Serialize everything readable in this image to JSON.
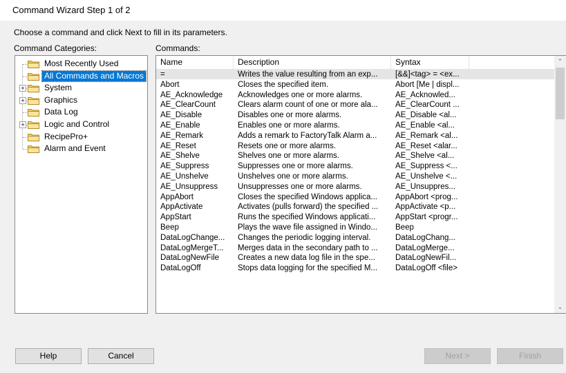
{
  "window": {
    "title": "Command Wizard Step 1 of 2"
  },
  "prompt": "Choose a command and click Next to fill in its parameters.",
  "labels": {
    "categories": "Command Categories:",
    "commands": "Commands:"
  },
  "categories": [
    {
      "label": "Most Recently Used",
      "expandable": false,
      "selected": false
    },
    {
      "label": "All Commands and Macros",
      "expandable": false,
      "selected": true
    },
    {
      "label": "System",
      "expandable": true,
      "selected": false
    },
    {
      "label": "Graphics",
      "expandable": true,
      "selected": false
    },
    {
      "label": "Data Log",
      "expandable": false,
      "selected": false
    },
    {
      "label": "Logic and Control",
      "expandable": true,
      "selected": false
    },
    {
      "label": "RecipePro+",
      "expandable": false,
      "selected": false
    },
    {
      "label": "Alarm and Event",
      "expandable": false,
      "selected": false
    }
  ],
  "columns": [
    "Name",
    "Description",
    "Syntax"
  ],
  "commands": [
    {
      "name": "=",
      "description": "Writes the value resulting from an exp...",
      "syntax": "[&&]<tag> = <ex..."
    },
    {
      "name": "Abort",
      "description": "Closes the specified item.",
      "syntax": "Abort [Me | displ..."
    },
    {
      "name": "AE_Acknowledge",
      "description": "Acknowledges one or more alarms.",
      "syntax": "AE_Acknowled..."
    },
    {
      "name": "AE_ClearCount",
      "description": "Clears alarm count of  one or more ala...",
      "syntax": "AE_ClearCount ..."
    },
    {
      "name": "AE_Disable",
      "description": "Disables one or more alarms.",
      "syntax": "AE_Disable <al..."
    },
    {
      "name": "AE_Enable",
      "description": "Enables one or more alarms.",
      "syntax": "AE_Enable <al..."
    },
    {
      "name": "AE_Remark",
      "description": "Adds a remark to FactoryTalk Alarm a...",
      "syntax": "AE_Remark <al..."
    },
    {
      "name": "AE_Reset",
      "description": "Resets one or more alarms.",
      "syntax": "AE_Reset <alar..."
    },
    {
      "name": "AE_Shelve",
      "description": "Shelves one or more alarms.",
      "syntax": "AE_Shelve <al..."
    },
    {
      "name": "AE_Suppress",
      "description": "Suppresses one or more alarms.",
      "syntax": "AE_Suppress <..."
    },
    {
      "name": "AE_Unshelve",
      "description": "Unshelves one or more alarms.",
      "syntax": "AE_Unshelve <..."
    },
    {
      "name": "AE_Unsuppress",
      "description": "Unsuppresses one or more alarms.",
      "syntax": "AE_Unsuppres..."
    },
    {
      "name": "AppAbort",
      "description": "Closes the specified Windows applica...",
      "syntax": "AppAbort <prog..."
    },
    {
      "name": "AppActivate",
      "description": "Activates (pulls forward) the specified ...",
      "syntax": "AppActivate <p..."
    },
    {
      "name": "AppStart",
      "description": "Runs the specified Windows applicati...",
      "syntax": "AppStart <progr..."
    },
    {
      "name": "Beep",
      "description": "Plays the wave file assigned in Windo...",
      "syntax": "Beep"
    },
    {
      "name": "DataLogChange...",
      "description": "Changes the periodic logging interval.",
      "syntax": "DataLogChang..."
    },
    {
      "name": "DataLogMergeT...",
      "description": "Merges data in the secondary path to ...",
      "syntax": "DataLogMerge..."
    },
    {
      "name": "DataLogNewFile",
      "description": "Creates a new data log file in the spe...",
      "syntax": "DataLogNewFil..."
    },
    {
      "name": "DataLogOff",
      "description": "Stops data logging for the specified M...",
      "syntax": "DataLogOff <file>"
    }
  ],
  "buttons": {
    "help": "Help",
    "cancel": "Cancel",
    "next": "Next >",
    "finish": "Finish"
  },
  "scroll_arrows": {
    "up": "⌃",
    "down": "⌄"
  },
  "colors": {
    "selection": "#0078d7",
    "dialog_bg": "#f0f0f0",
    "folder": "#f5d06b"
  }
}
